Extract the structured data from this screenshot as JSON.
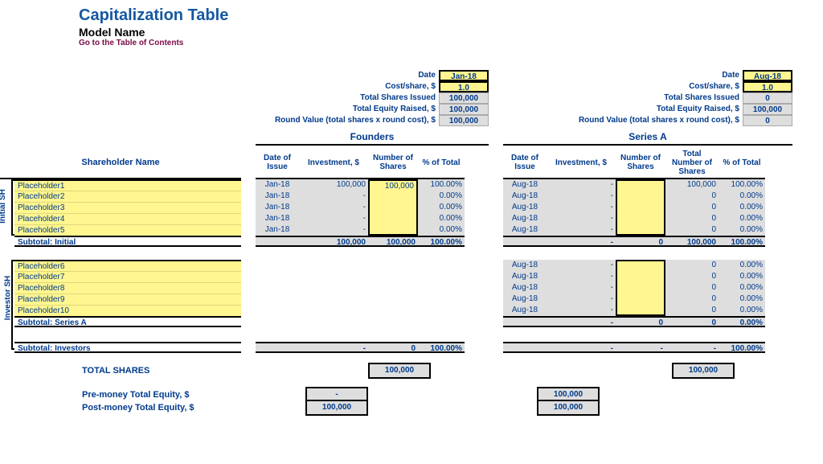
{
  "title": "Capitalization Table",
  "subtitle": "Model Name",
  "toc_link": "Go to the Table of Contents",
  "labels": {
    "date": "Date",
    "cost": "Cost/share, $",
    "tsi": "Total Shares Issued",
    "ter": "Total Equity Raised, $",
    "rv": "Round Value (total shares x round cost), $",
    "shareholder": "Shareholder Name",
    "date_issue": "Date of Issue",
    "investment": "Investment, $",
    "num_shares": "Number of Shares",
    "pct_total": "% of Total",
    "total_num_shares": "Total Number of Shares",
    "initial_sh": "Initial SH",
    "investor_sh": "Investor SH",
    "sub_initial": "Subtotal: Initial",
    "sub_seriesa": "Subtotal: Series A",
    "sub_investors": "Subtotal: Investors",
    "total_shares": "TOTAL SHARES",
    "pre_money": "Pre-money Total Equity, $",
    "post_money": "Post-money Total Equity, $"
  },
  "rounds": {
    "founders": {
      "title": "Founders",
      "date": "Jan-18",
      "cost": "1.0",
      "tsi": "100,000",
      "ter": "100,000",
      "rv": "100,000"
    },
    "seriesa": {
      "title": "Series A",
      "date": "Aug-18",
      "cost": "1.0",
      "tsi": "0",
      "ter": "100,000",
      "rv": "0"
    }
  },
  "initial": [
    {
      "name": "Placeholder1",
      "f_date": "Jan-18",
      "f_inv": "100,000",
      "f_sh": "100,000",
      "f_pct": "100.00%",
      "a_date": "Aug-18",
      "a_inv": "-",
      "a_sh": "",
      "a_tot": "100,000",
      "a_pct": "100.00%"
    },
    {
      "name": "Placeholder2",
      "f_date": "Jan-18",
      "f_inv": "-",
      "f_sh": "",
      "f_pct": "0.00%",
      "a_date": "Aug-18",
      "a_inv": "-",
      "a_sh": "",
      "a_tot": "0",
      "a_pct": "0.00%"
    },
    {
      "name": "Placeholder3",
      "f_date": "Jan-18",
      "f_inv": "-",
      "f_sh": "",
      "f_pct": "0.00%",
      "a_date": "Aug-18",
      "a_inv": "-",
      "a_sh": "",
      "a_tot": "0",
      "a_pct": "0.00%"
    },
    {
      "name": "Placeholder4",
      "f_date": "Jan-18",
      "f_inv": "-",
      "f_sh": "",
      "f_pct": "0.00%",
      "a_date": "Aug-18",
      "a_inv": "-",
      "a_sh": "",
      "a_tot": "0",
      "a_pct": "0.00%"
    },
    {
      "name": "Placeholder5",
      "f_date": "Jan-18",
      "f_inv": "-",
      "f_sh": "",
      "f_pct": "0.00%",
      "a_date": "Aug-18",
      "a_inv": "-",
      "a_sh": "",
      "a_tot": "0",
      "a_pct": "0.00%"
    }
  ],
  "sub_initial": {
    "f_inv": "100,000",
    "f_sh": "100,000",
    "f_pct": "100.00%",
    "a_inv": "-",
    "a_sh": "0",
    "a_tot": "100,000",
    "a_pct": "100.00%"
  },
  "investors": [
    {
      "name": "Placeholder6",
      "a_date": "Aug-18",
      "a_inv": "-",
      "a_sh": "",
      "a_tot": "0",
      "a_pct": "0.00%"
    },
    {
      "name": "Placeholder7",
      "a_date": "Aug-18",
      "a_inv": "-",
      "a_sh": "",
      "a_tot": "0",
      "a_pct": "0.00%"
    },
    {
      "name": "Placeholder8",
      "a_date": "Aug-18",
      "a_inv": "-",
      "a_sh": "",
      "a_tot": "0",
      "a_pct": "0.00%"
    },
    {
      "name": "Placeholder9",
      "a_date": "Aug-18",
      "a_inv": "-",
      "a_sh": "",
      "a_tot": "0",
      "a_pct": "0.00%"
    },
    {
      "name": "Placeholder10",
      "a_date": "Aug-18",
      "a_inv": "-",
      "a_sh": "",
      "a_tot": "0",
      "a_pct": "0.00%"
    }
  ],
  "sub_seriesa": {
    "a_inv": "-",
    "a_sh": "0",
    "a_tot": "0",
    "a_pct": "0.00%"
  },
  "sub_investors": {
    "f_inv": "-",
    "f_sh": "0",
    "f_pct": "100.00%",
    "a_inv": "-",
    "a_sh": "-",
    "a_tot": "-",
    "a_pct": "100.00%"
  },
  "totals": {
    "founders_shares": "100,000",
    "seriesa_shares": "100,000",
    "founders_pre": "-",
    "founders_post": "100,000",
    "seriesa_pre": "100,000",
    "seriesa_post": "100,000"
  }
}
